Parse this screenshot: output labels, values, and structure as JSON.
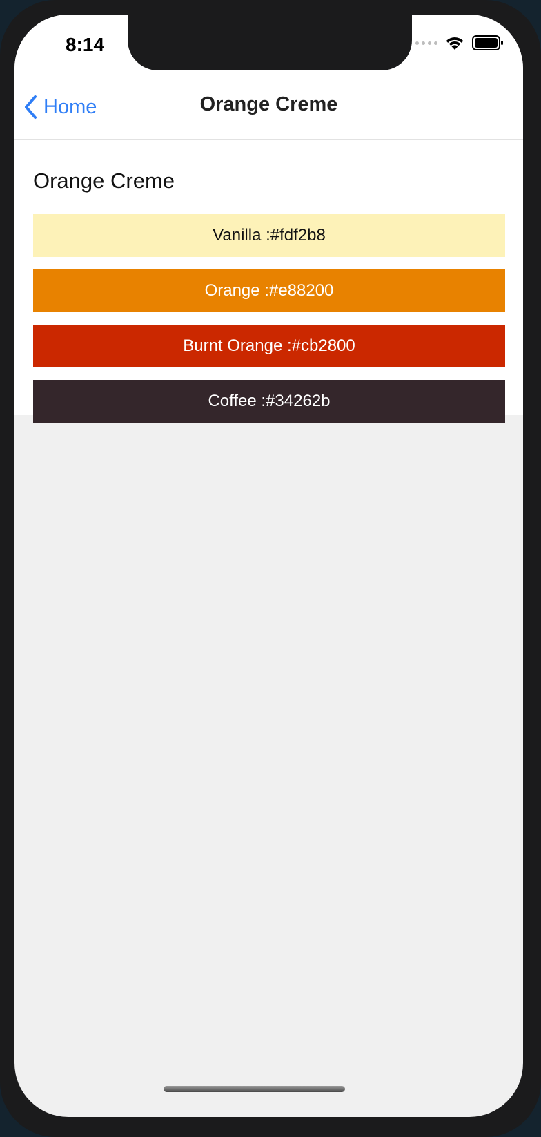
{
  "status_bar": {
    "time": "8:14",
    "icons": [
      "signal-icon",
      "wifi-icon",
      "battery-icon"
    ]
  },
  "nav": {
    "back_label": "Home",
    "title": "Orange Creme",
    "accent_color": "#2f7ef6"
  },
  "palette": {
    "title": "Orange Creme",
    "swatches": [
      {
        "label": "Vanilla :#fdf2b8",
        "color": "#fdf2b8",
        "text_color": "#111111"
      },
      {
        "label": "Orange :#e88200",
        "color": "#e88200",
        "text_color": "#ffffff"
      },
      {
        "label": "Burnt Orange :#cb2800",
        "color": "#cb2800",
        "text_color": "#ffffff"
      },
      {
        "label": "Coffee :#34262b",
        "color": "#34262b",
        "text_color": "#ffffff"
      }
    ]
  }
}
